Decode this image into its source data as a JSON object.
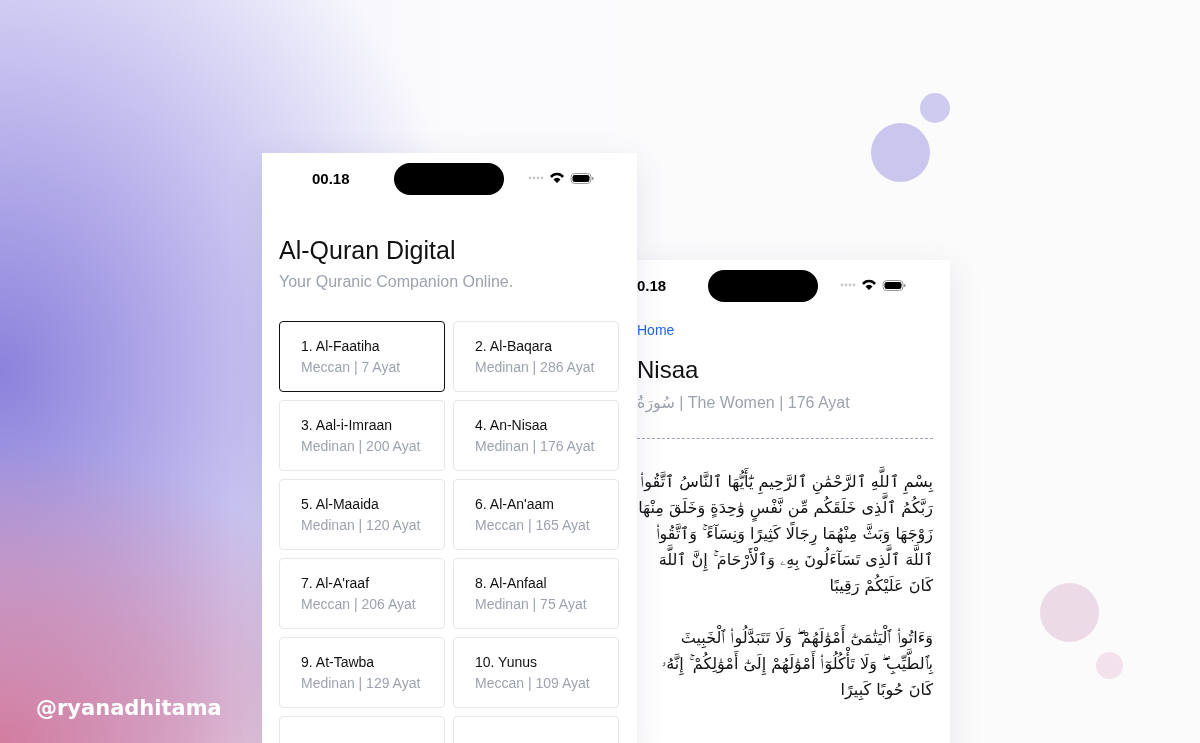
{
  "credit": "@ryanadhitama",
  "home_screen": {
    "status_time": "00.18",
    "title": "Al-Quran Digital",
    "subtitle": "Your Quranic Companion Online.",
    "surahs": [
      {
        "name": "1. Al-Faatiha",
        "info": "Meccan | 7 Ayat",
        "selected": true
      },
      {
        "name": "2. Al-Baqara",
        "info": "Medinan | 286 Ayat",
        "selected": false
      },
      {
        "name": "3. Aal-i-Imraan",
        "info": "Medinan | 200 Ayat",
        "selected": false
      },
      {
        "name": "4. An-Nisaa",
        "info": "Medinan | 176 Ayat",
        "selected": false
      },
      {
        "name": "5. Al-Maaida",
        "info": "Medinan | 120 Ayat",
        "selected": false
      },
      {
        "name": "6. Al-An'aam",
        "info": "Meccan | 165 Ayat",
        "selected": false
      },
      {
        "name": "7. Al-A'raaf",
        "info": "Meccan | 206 Ayat",
        "selected": false
      },
      {
        "name": "8. Al-Anfaal",
        "info": "Medinan | 75 Ayat",
        "selected": false
      },
      {
        "name": "9. At-Tawba",
        "info": "Medinan | 129 Ayat",
        "selected": false
      },
      {
        "name": "10. Yunus",
        "info": "Meccan | 109 Ayat",
        "selected": false
      }
    ]
  },
  "detail_screen": {
    "status_time": "0.18",
    "back_link": "Home",
    "title": "Nisaa",
    "subtitle": "سُورَةُ | The Women | 176 Ayat",
    "verses": [
      "بِسْمِ ٱللَّهِ ٱلرَّحْمَٰنِ ٱلرَّحِيمِ يَٰٓأَيُّهَا ٱلنَّاسُ ٱتَّقُوا۟ رَبَّكُمُ ٱلَّذِى خَلَقَكُم مِّن نَّفْسٍ وَٰحِدَةٍ وَخَلَقَ مِنْهَا زَوْجَهَا وَبَثَّ مِنْهُمَا رِجَالًا كَثِيرًا وَنِسَآءً ۚ وَٱتَّقُوا۟ ٱللَّهَ ٱلَّذِى تَسَآءَلُونَ بِهِۦ وَٱلْأَرْحَامَ ۚ إِنَّ ٱللَّهَ كَانَ عَلَيْكُمْ رَقِيبًا",
      "وَءَاتُوا۟ ٱلْيَتَٰمَىٰٓ أَمْوَٰلَهُمْ ۖ وَلَا تَتَبَدَّلُوا۟ ٱلْخَبِيثَ بِٱلطَّيِّبِ ۖ وَلَا تَأْكُلُوٓا۟ أَمْوَٰلَهُمْ إِلَىٰٓ أَمْوَٰلِكُمْ ۚ إِنَّهُۥ كَانَ حُوبًا كَبِيرًا"
    ]
  }
}
